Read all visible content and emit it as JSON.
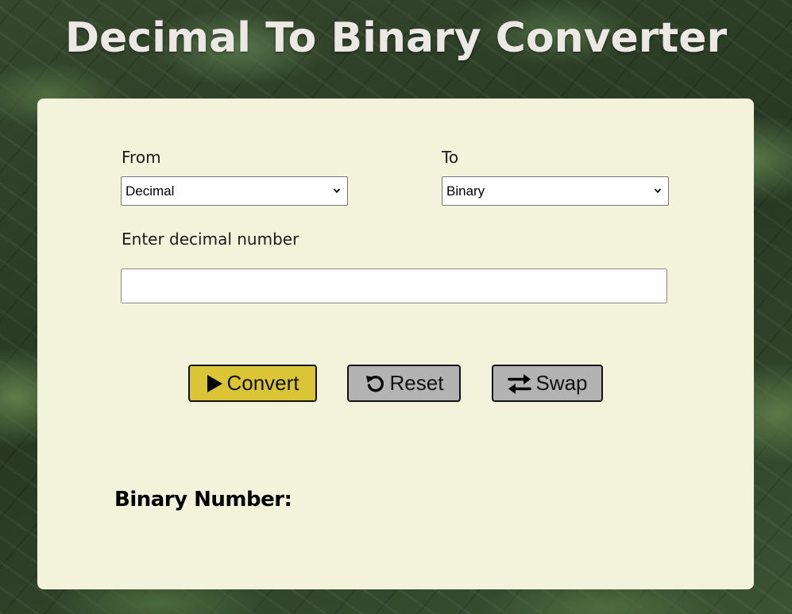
{
  "app": {
    "title": "Decimal To Binary Converter"
  },
  "form": {
    "from_label": "From",
    "from_selected": "Decimal",
    "to_label": "To",
    "to_selected": "Binary",
    "input_label": "Enter decimal number",
    "input_value": "",
    "input_placeholder": ""
  },
  "buttons": {
    "convert": {
      "label": "Convert",
      "icon": "play-icon",
      "color": "#d9c535"
    },
    "reset": {
      "label": "Reset",
      "icon": "reset-icon",
      "color": "#b3b3b3"
    },
    "swap": {
      "label": "Swap",
      "icon": "swap-icon",
      "color": "#b3b3b3"
    }
  },
  "result": {
    "label": "Binary Number:",
    "value": ""
  },
  "colors": {
    "card_background": "#f3f3db",
    "title_text": "#ece9e4"
  }
}
